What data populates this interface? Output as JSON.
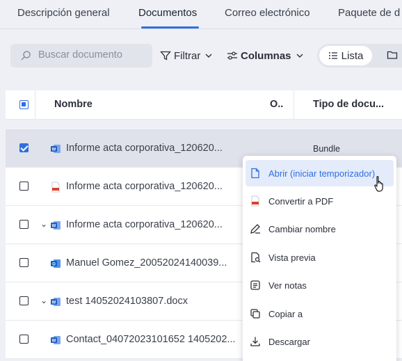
{
  "tabs": [
    {
      "label": "Descripción general"
    },
    {
      "label": "Documentos"
    },
    {
      "label": "Correo electrónico"
    },
    {
      "label": "Paquete de d"
    }
  ],
  "toolbar": {
    "search_placeholder": "Buscar documento",
    "filter_label": "Filtrar",
    "columns_label": "Columnas",
    "view_list_label": "Lista"
  },
  "table": {
    "headers": {
      "name": "Nombre",
      "owner": "O..",
      "type": "Tipo de docu..."
    },
    "rows": [
      {
        "name": "Informe acta corporativa_120620...",
        "type": "Bundle",
        "icon": "word-icon",
        "checked": true
      },
      {
        "name": "Informe acta corporativa_120620...",
        "type": "",
        "icon": "pdf-icon",
        "checked": false
      },
      {
        "name": "Informe acta corporativa_120620...",
        "type": "",
        "icon": "word-icon",
        "checked": false,
        "expand": true
      },
      {
        "name": "Manuel Gomez_20052024140039...",
        "type": "",
        "icon": "outlook-icon",
        "checked": false
      },
      {
        "name": "test 14052024103807.docx",
        "type": "",
        "icon": "word-icon",
        "checked": false,
        "expand": true
      },
      {
        "name": "Contact_04072023101652 1405202...",
        "type": "",
        "icon": "word-icon",
        "checked": false
      }
    ]
  },
  "context_menu": {
    "items": [
      {
        "label": "Abrir (iniciar temporizador)",
        "icon": "file-icon"
      },
      {
        "label": "Convertir a PDF",
        "icon": "pdf-icon"
      },
      {
        "label": "Cambiar nombre",
        "icon": "pencil-icon"
      },
      {
        "label": "Vista previa",
        "icon": "preview-icon"
      },
      {
        "label": "Ver notas",
        "icon": "notes-icon"
      },
      {
        "label": "Copiar a",
        "icon": "copy-icon"
      },
      {
        "label": "Descargar",
        "icon": "download-icon"
      }
    ]
  },
  "colors": {
    "accent": "#2f6fe0",
    "hover_bg": "#e4ebfa",
    "selected_row": "#dfe2ea"
  }
}
